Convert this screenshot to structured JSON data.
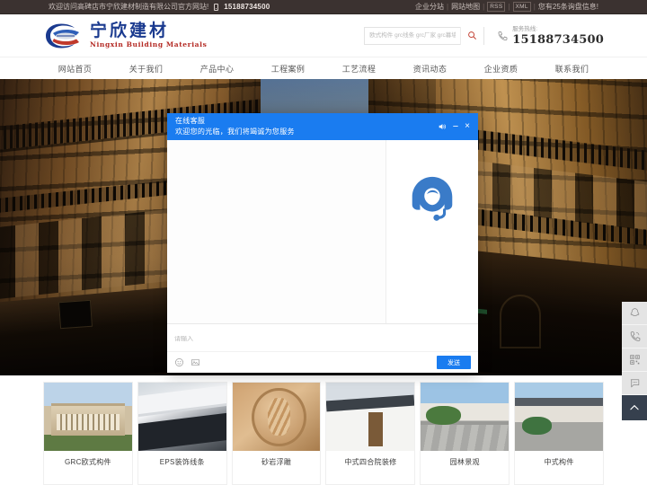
{
  "topbar": {
    "welcome": "欢迎访问高碑店市宁欣建材制造有限公司官方网站!",
    "phone": "15188734500",
    "links": [
      "企业分站",
      "网站地图"
    ],
    "tags": [
      "RSS",
      "XML"
    ],
    "inquiry": "您有25条询盘信息!",
    "separator": "|",
    "bg_color": "#3b3230"
  },
  "header": {
    "logo_cn": "宁欣建材",
    "logo_en": "Ningxin Building Materials",
    "logo_color": "#1a3a8f",
    "logo_en_color": "#b42a24",
    "search": {
      "placeholder": "欧式构件 grc线条 grc厂家 grc幕墙大板",
      "value": ""
    },
    "hotline_label": "服务热线:",
    "hotline_number": "15188734500"
  },
  "nav": {
    "items": [
      {
        "label": "网站首页"
      },
      {
        "label": "关于我们"
      },
      {
        "label": "产品中心"
      },
      {
        "label": "工程案例"
      },
      {
        "label": "工艺流程"
      },
      {
        "label": "资讯动态"
      },
      {
        "label": "企业资质"
      },
      {
        "label": "联系我们"
      }
    ]
  },
  "chat": {
    "title": "在线客服",
    "subtitle": "欢迎您的光临，我们将竭诚为您服务",
    "header_color": "#1a7cf0",
    "controls": {
      "sound": "sound-icon",
      "minimize": "−",
      "close": "×"
    },
    "agent_avatar": "headset-agent-icon",
    "input_placeholder": "请输入",
    "input_value": "",
    "tools": [
      "emoji-icon",
      "image-icon"
    ],
    "send_label": "发送"
  },
  "floatbar": {
    "items": [
      {
        "name": "qq-icon"
      },
      {
        "name": "phone-icon"
      },
      {
        "name": "qrcode-icon"
      },
      {
        "name": "message-icon"
      },
      {
        "name": "back-to-top-icon"
      }
    ],
    "top_bg": "#36404e"
  },
  "products": {
    "items": [
      {
        "label": "GRC欧式构件",
        "thumb": "grc-european-component"
      },
      {
        "label": "EPS装饰线条",
        "thumb": "eps-decorative-line"
      },
      {
        "label": "砂岩浮雕",
        "thumb": "sandstone-relief"
      },
      {
        "label": "中式四合院装修",
        "thumb": "chinese-courtyard"
      },
      {
        "label": "园林景观",
        "thumb": "garden-landscape"
      },
      {
        "label": "中式构件",
        "thumb": "chinese-component"
      }
    ]
  },
  "banner": {
    "alt": "european-classical-building-banner"
  }
}
